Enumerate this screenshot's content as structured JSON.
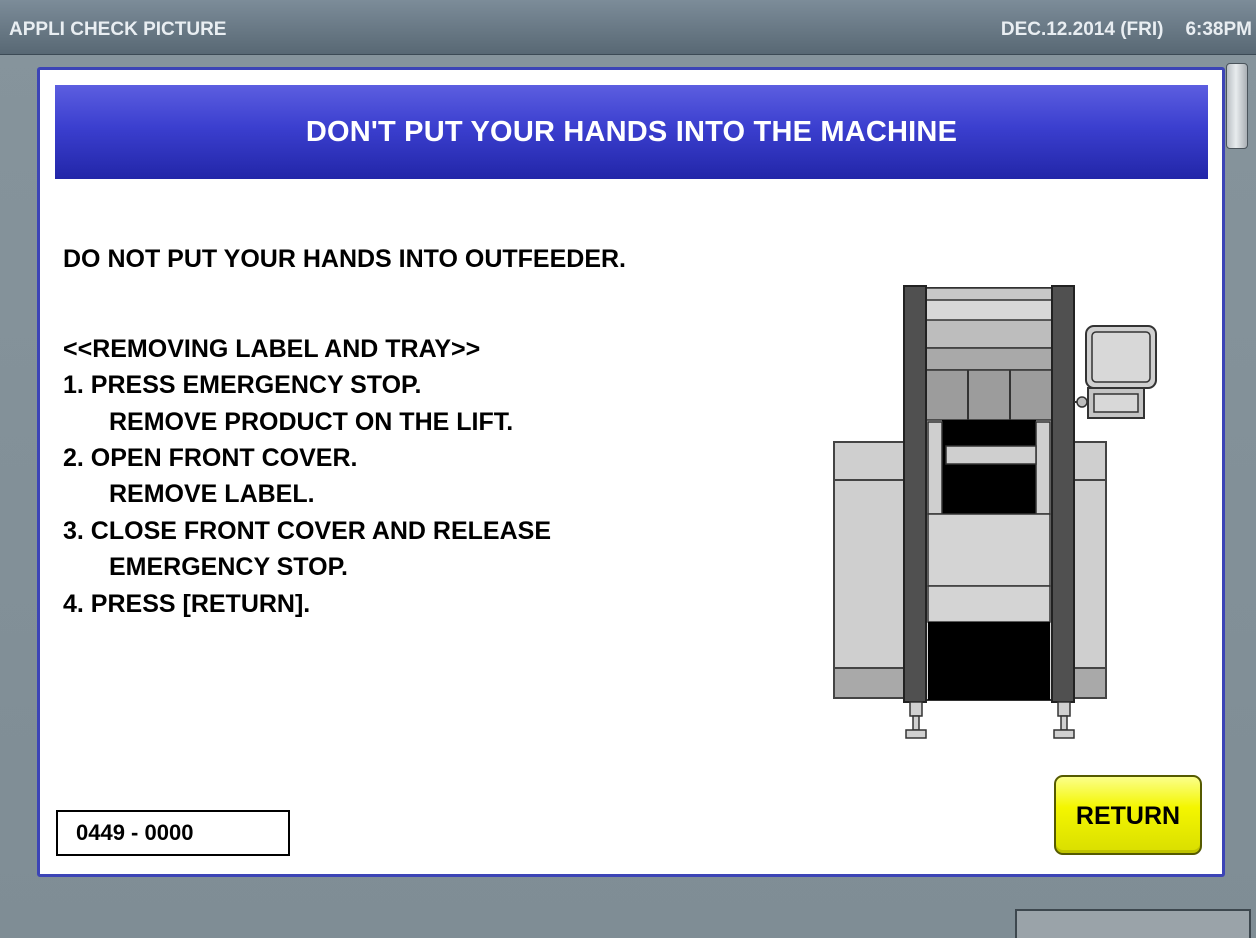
{
  "header": {
    "title": "APPLI CHECK PICTURE",
    "date": "DEC.12.2014 (FRI)",
    "time": "6:38PM"
  },
  "dialog": {
    "title": "DON'T PUT YOUR HANDS INTO THE MACHINE",
    "lines": [
      "DO NOT PUT YOUR HANDS INTO OUTFEEDER.",
      "<<REMOVING LABEL AND TRAY>>",
      "1. PRESS EMERGENCY STOP.",
      "REMOVE PRODUCT ON THE LIFT.",
      "2. OPEN FRONT COVER.",
      "REMOVE LABEL.",
      "3. CLOSE FRONT COVER AND RELEASE",
      "EMERGENCY STOP.",
      "4. PRESS [RETURN]."
    ],
    "code": "0449 - 0000",
    "return_label": "RETURN",
    "image_icon": "machine-diagram-icon"
  },
  "colors": {
    "banner": "#3b3fcf",
    "return_button": "#f4f600",
    "frame": "#3c44b6"
  }
}
